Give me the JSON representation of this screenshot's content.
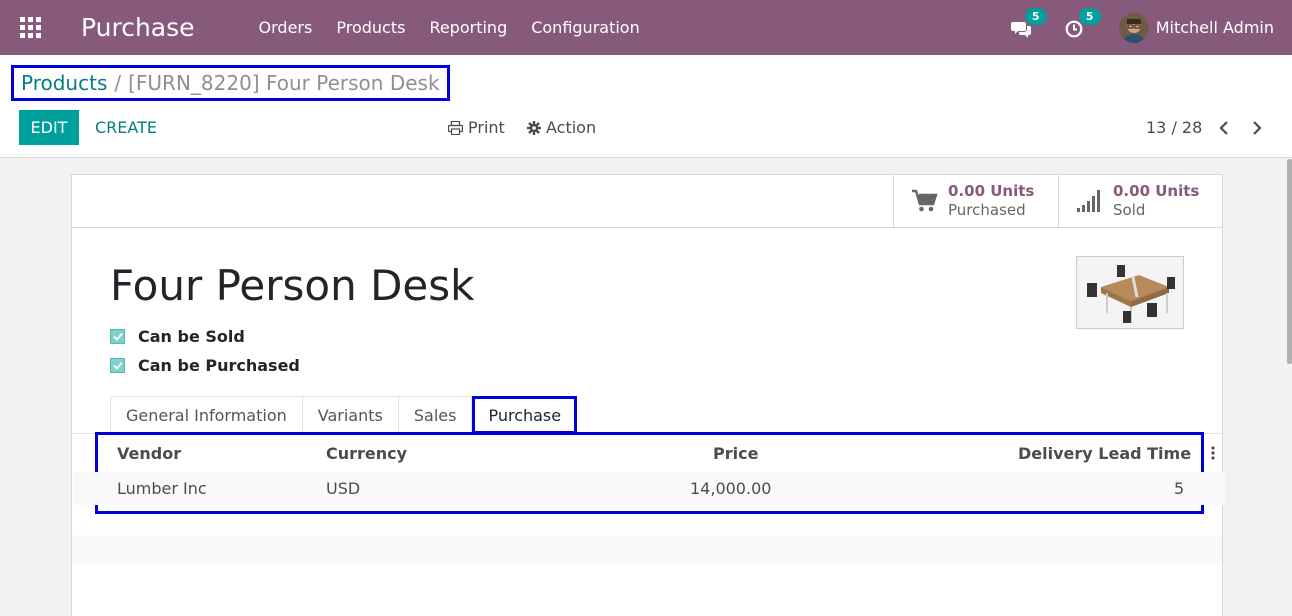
{
  "navbar": {
    "app_title": "Purchase",
    "menu": [
      "Orders",
      "Products",
      "Reporting",
      "Configuration"
    ],
    "messages_count": "5",
    "activities_count": "5",
    "user_name": "Mitchell Admin",
    "bg_color": "#875a7b"
  },
  "breadcrumb": {
    "parent": "Products",
    "separator": "/",
    "current": "[FURN_8220] Four Person Desk"
  },
  "actions": {
    "edit": "EDIT",
    "create": "CREATE",
    "print": "Print",
    "action": "Action"
  },
  "pager": {
    "value": "13 / 28"
  },
  "stats": {
    "purchased_value": "0.00 Units",
    "purchased_label": "Purchased",
    "sold_value": "0.00 Units",
    "sold_label": "Sold"
  },
  "product": {
    "name": "Four Person Desk",
    "can_be_sold_label": "Can be Sold",
    "can_be_purchased_label": "Can be Purchased"
  },
  "tabs": [
    "General Information",
    "Variants",
    "Sales",
    "Purchase"
  ],
  "vendor_table": {
    "headers": {
      "vendor": "Vendor",
      "currency": "Currency",
      "price": "Price",
      "lead_time": "Delivery Lead Time"
    },
    "rows": [
      {
        "vendor": "Lumber Inc",
        "currency": "USD",
        "price": "14,000.00",
        "lead_time": "5"
      }
    ]
  },
  "colors": {
    "accent": "#00a09d",
    "link": "#017e84",
    "brand": "#875a7b",
    "highlight_box": "#0000dd"
  }
}
